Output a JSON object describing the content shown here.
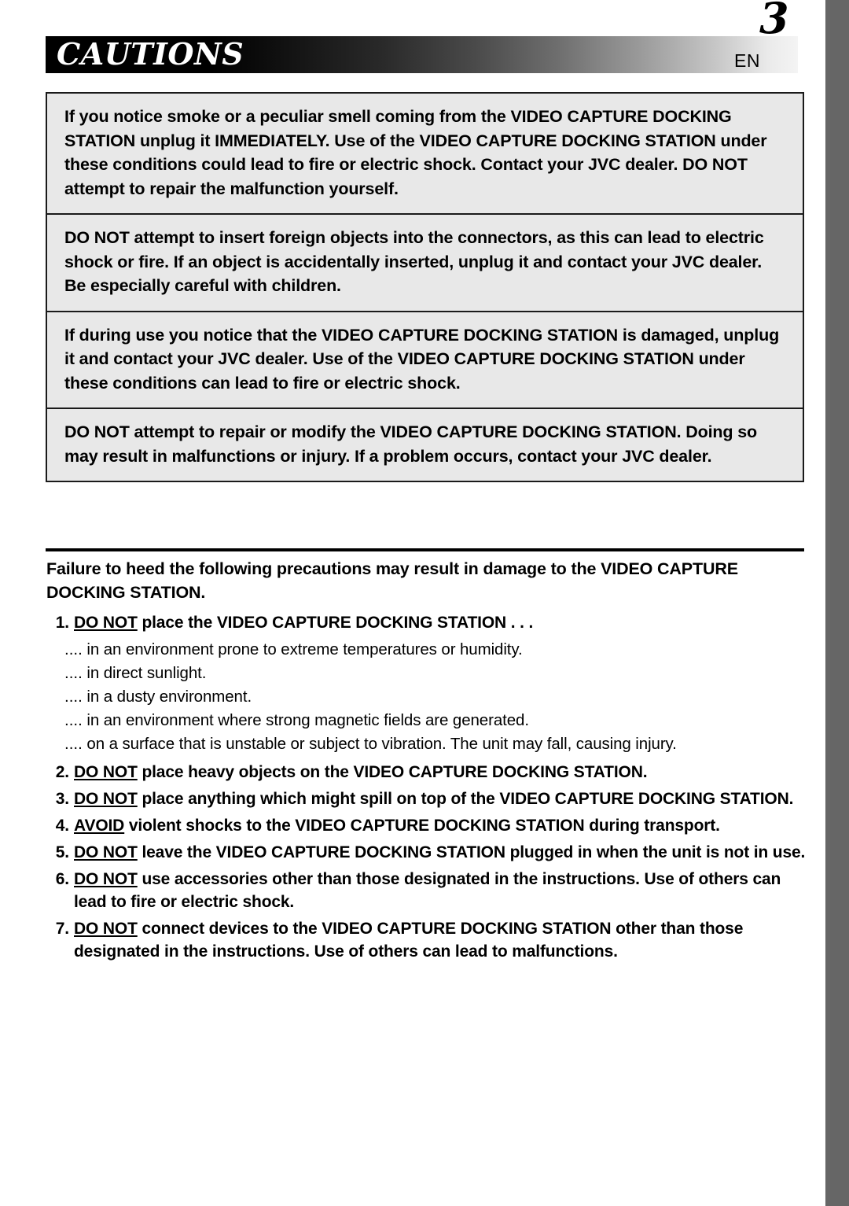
{
  "header": {
    "title": "CAUTIONS",
    "language_code": "EN",
    "page_number": "3"
  },
  "caution_boxes": [
    {
      "id": "smoke-or-smell",
      "text": "If you notice smoke or a peculiar smell coming from the VIDEO CAPTURE DOCKING STATION unplug it IMMEDIATELY. Use of the VIDEO CAPTURE DOCKING STATION under these conditions could lead to fire or electric shock. Contact your JVC dealer. DO NOT attempt to repair the malfunction yourself."
    },
    {
      "id": "foreign-objects",
      "text": "DO NOT attempt to insert foreign objects into the connectors, as this can lead to electric shock or fire. If an object is accidentally inserted, unplug it and contact your JVC dealer. Be especially careful with children."
    },
    {
      "id": "damaged-unit",
      "text": "If during use you notice that the VIDEO CAPTURE DOCKING STATION is damaged, unplug it and contact your JVC dealer. Use of the VIDEO CAPTURE DOCKING STATION under these conditions can lead to fire or electric shock."
    },
    {
      "id": "repair-or-modify",
      "text": "DO NOT attempt to repair or modify the VIDEO CAPTURE DOCKING STATION. Doing so may result in malfunctions or injury. If a problem occurs, contact your JVC dealer."
    }
  ],
  "precautions": {
    "heading": "Failure to heed the following precautions may result in damage to the VIDEO CAPTURE DOCKING STATION.",
    "items": [
      {
        "number": "1.",
        "emphasis": "DO NOT",
        "text": " place the VIDEO CAPTURE DOCKING STATION . . .",
        "sub_items": [
          {
            "dots": "....",
            "text": " in an environment prone to extreme temperatures or humidity."
          },
          {
            "dots": "....",
            "text": " in direct sunlight."
          },
          {
            "dots": "....",
            "text": " in a dusty environment."
          },
          {
            "dots": "....",
            "text": " in an environment where strong magnetic fields are generated."
          },
          {
            "dots": "....",
            "text": " on a surface that is unstable or subject to vibration. The unit may fall, causing injury."
          }
        ]
      },
      {
        "number": "2.",
        "emphasis": "DO NOT",
        "text": " place heavy objects on the VIDEO CAPTURE DOCKING STATION.",
        "sub_items": []
      },
      {
        "number": "3.",
        "emphasis": "DO NOT",
        "text": " place anything which might spill on top of the VIDEO CAPTURE DOCKING STATION.",
        "sub_items": []
      },
      {
        "number": "4.",
        "emphasis": "AVOID",
        "text": " violent shocks to the VIDEO CAPTURE DOCKING STATION during transport.",
        "sub_items": []
      },
      {
        "number": "5.",
        "emphasis": "DO NOT",
        "text": " leave the VIDEO CAPTURE DOCKING STATION plugged in when the unit is not in use.",
        "sub_items": []
      },
      {
        "number": "6.",
        "emphasis": "DO NOT",
        "text": " use accessories other than those designated in the instructions. Use of others can lead to fire or electric shock.",
        "sub_items": []
      },
      {
        "number": "7.",
        "emphasis": "DO NOT",
        "text": " connect devices to the VIDEO CAPTURE DOCKING STATION other than those designated in the instructions. Use of others can lead to malfunctions.",
        "sub_items": []
      }
    ]
  },
  "colors": {
    "box_fill": "#e8e8e8",
    "box_border": "#1a1a1a",
    "edge_strip": "#666666",
    "header_gradient_start": "#000000",
    "header_gradient_end": "#f4f4f4"
  }
}
